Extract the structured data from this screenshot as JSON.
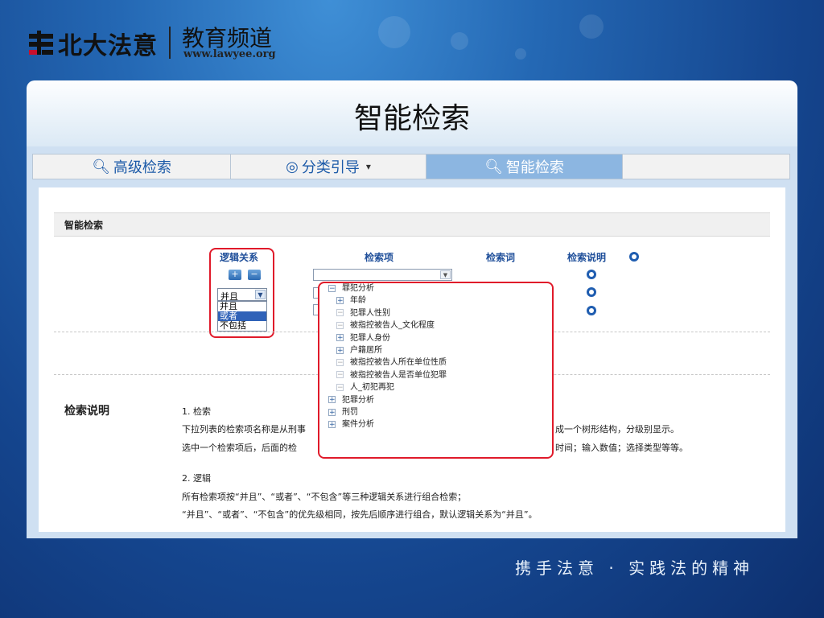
{
  "header": {
    "brand": "北大法意",
    "channel": "教育频道",
    "url": "www.lawyee.org"
  },
  "title": "智能检索",
  "tabs": [
    {
      "label": "高级检索",
      "icon": "search-icon"
    },
    {
      "label": "分类引导",
      "icon": "target-icon",
      "suffix": "▾"
    },
    {
      "label": "智能检索",
      "icon": "search-icon",
      "active": true
    }
  ],
  "section_title": "智能检索",
  "columns": {
    "logic": "逻辑关系",
    "item": "检索项",
    "keyword": "检索词",
    "explain": "检索说明"
  },
  "buttons": {
    "add": "+",
    "remove": "−"
  },
  "logic_select": {
    "value": "并且",
    "options": [
      "并且",
      "或者",
      "不包括"
    ],
    "highlighted": "或者"
  },
  "tree": [
    {
      "label": "罪犯分析",
      "level": 0,
      "box": "−"
    },
    {
      "label": "年龄",
      "level": 1,
      "box": "+"
    },
    {
      "label": "犯罪人性别",
      "level": 1,
      "box": "−"
    },
    {
      "label": "被指控被告人_文化程度",
      "level": 1,
      "box": "−"
    },
    {
      "label": "犯罪人身份",
      "level": 1,
      "box": "+"
    },
    {
      "label": "户籍居所",
      "level": 1,
      "box": "+"
    },
    {
      "label": "被指控被告人所在单位性质",
      "level": 1,
      "box": "−"
    },
    {
      "label": "被指控被告人是否单位犯罪",
      "level": 1,
      "box": "−"
    },
    {
      "label": "人_初犯再犯",
      "level": 1,
      "box": "−"
    },
    {
      "label": "犯罪分析",
      "level": 0,
      "box": "+"
    },
    {
      "label": "刑罚",
      "level": 0,
      "box": "+"
    },
    {
      "label": "案件分析",
      "level": 0,
      "box": "+"
    }
  ],
  "description": {
    "title": "检索说明",
    "s1_title": "1. 检索",
    "s1_line1_left": "下拉列表的检索项名称是从刑事",
    "s1_line1_right": "成一个树形结构，分级别显示。",
    "s1_line2_left": "选中一个检索项后，后面的检",
    "s1_line2_right": "时间；输入数值；选择类型等等。",
    "s2_title": "2. 逻辑",
    "s2_line1": "所有检索项按“并且”、“或者”、“不包含”等三种逻辑关系进行组合检索；",
    "s2_line2": "“并且”、“或者”、“不包含”的优先级相同，按先后顺序进行组合，默认逻辑关系为“并且”。"
  },
  "slogan": "携手法意 · 实践法的精神",
  "colors": {
    "highlight_border": "#e01a2a",
    "link_blue": "#1f4f9a",
    "active_tab": "#8cb6e1"
  }
}
